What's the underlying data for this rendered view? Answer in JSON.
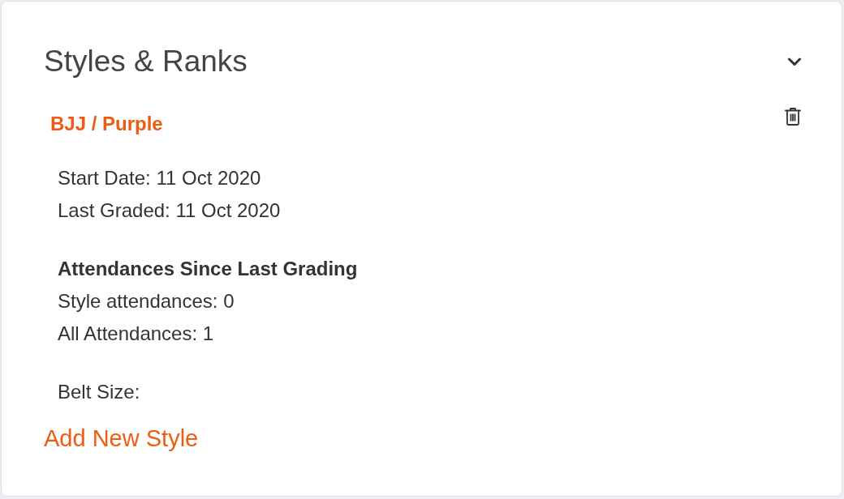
{
  "panel": {
    "title": "Styles & Ranks"
  },
  "styles": [
    {
      "name": "BJJ / Purple",
      "dates": [
        "Start Date: 11 Oct 2020",
        "Last Graded: 11 Oct 2020"
      ],
      "attendance_heading": "Attendances Since Last Grading",
      "attendances": [
        "Style attendances: 0",
        "All Attendances: 1"
      ],
      "belt_size": "Belt Size:"
    }
  ],
  "add_link": "Add New Style"
}
